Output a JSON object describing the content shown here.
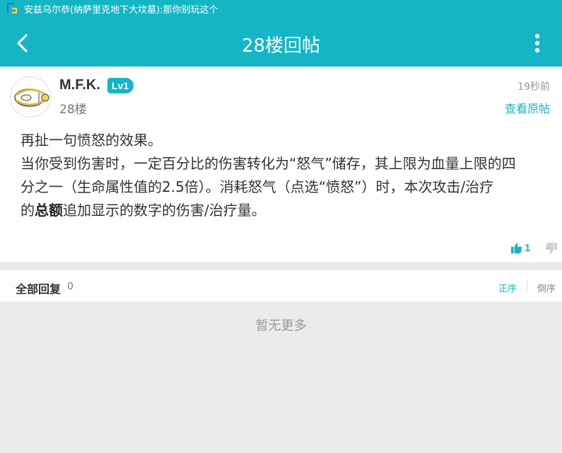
{
  "status_bar": {
    "notification_text": "安兹乌尔恭(纳萨里克地下大坟墓):那你别玩这个",
    "app_icon": "app-notification-icon"
  },
  "app_bar": {
    "title": "28楼回帖",
    "back_icon": "back-arrow-icon",
    "more_icon": "more-vertical-icon",
    "color": "#14b6c6"
  },
  "post": {
    "username": "M.F.K.",
    "level": "Lv1",
    "floor": "28楼",
    "time": "19秒前",
    "view_original": "查看原帖",
    "content": {
      "line1": "再扯一句愤怒的效果。",
      "line2": "当你受到伤害时，一定百分比的伤害转化为“怒气”储存，其上限为血量上限的四",
      "line3": "分之一（生命属性值的2.5倍）。消耗怒气（点选“愤怒”）时，本次攻击/治疗",
      "line4_pre": "的",
      "line4_bold": "总额",
      "line4_post": "追加显示的数字的伤害/治疗量。"
    },
    "likes": "1",
    "like_icon": "thumbs-up-icon",
    "dislike_icon": "thumbs-down-icon"
  },
  "replies": {
    "label": "全部回复",
    "count": "0",
    "sort_asc": "正序",
    "sort_desc": "倒序"
  },
  "empty_text": "暂无更多"
}
